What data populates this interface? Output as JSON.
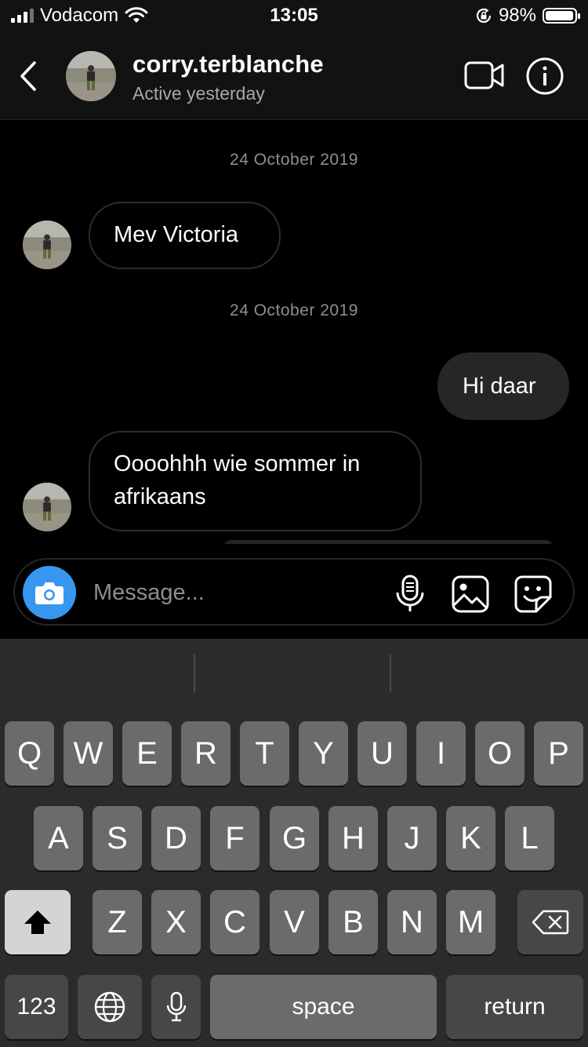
{
  "status_bar": {
    "carrier": "Vodacom",
    "time": "13:05",
    "battery": "98%",
    "battery_level": 0.98
  },
  "header": {
    "username": "corry.terblanche",
    "status": "Active yesterday"
  },
  "chat": {
    "date_1": "24 October 2019",
    "msg_1": "Mev Victoria",
    "date_2": "24 October 2019",
    "msg_2": "Hi daar",
    "msg_3_line1": "Oooohhh wie sommer in",
    "msg_3_line2": "afrikaans"
  },
  "composer": {
    "placeholder": "Message..."
  },
  "keyboard": {
    "row1": [
      "Q",
      "W",
      "E",
      "R",
      "T",
      "Y",
      "U",
      "I",
      "O",
      "P"
    ],
    "row2": [
      "A",
      "S",
      "D",
      "F",
      "G",
      "H",
      "J",
      "K",
      "L"
    ],
    "row3": [
      "Z",
      "X",
      "C",
      "V",
      "B",
      "N",
      "M"
    ],
    "numbers_label": "123",
    "space_label": "space",
    "return_label": "return"
  },
  "colors": {
    "accent": "#3797f0",
    "bubble_out": "#262626",
    "keyboard_bg": "#2b2b2b"
  }
}
